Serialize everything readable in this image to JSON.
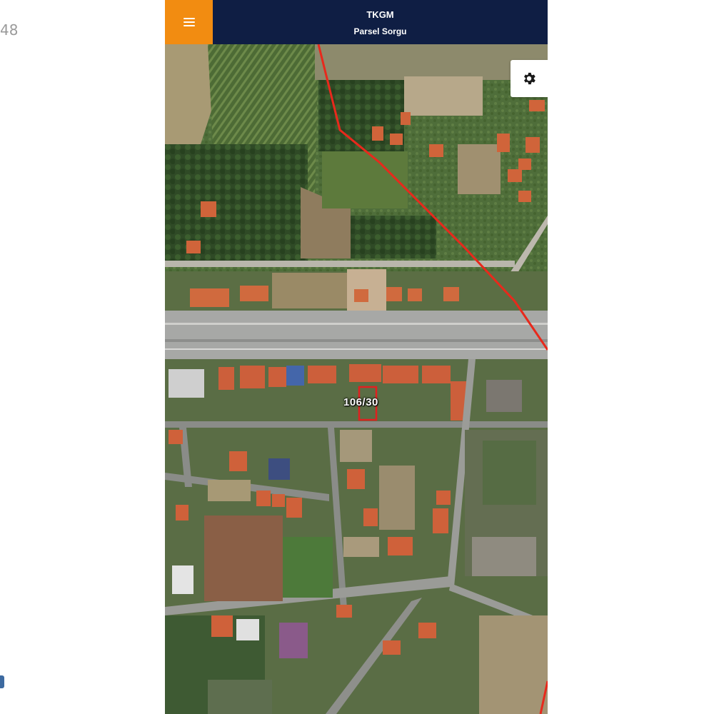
{
  "edge": {
    "fragment_text": "48"
  },
  "header": {
    "title": "TKGM",
    "subtitle": "Parsel Sorgu",
    "menu_icon": "hamburger-menu-icon",
    "background_color": "#0f1e44",
    "menu_button_color": "#f28c11"
  },
  "map": {
    "view": "satellite",
    "settings_icon": "gear-icon",
    "selected_parcel": {
      "label": "106/30",
      "outline_color": "#e02020"
    },
    "boundary_line_color": "#e8291c"
  }
}
